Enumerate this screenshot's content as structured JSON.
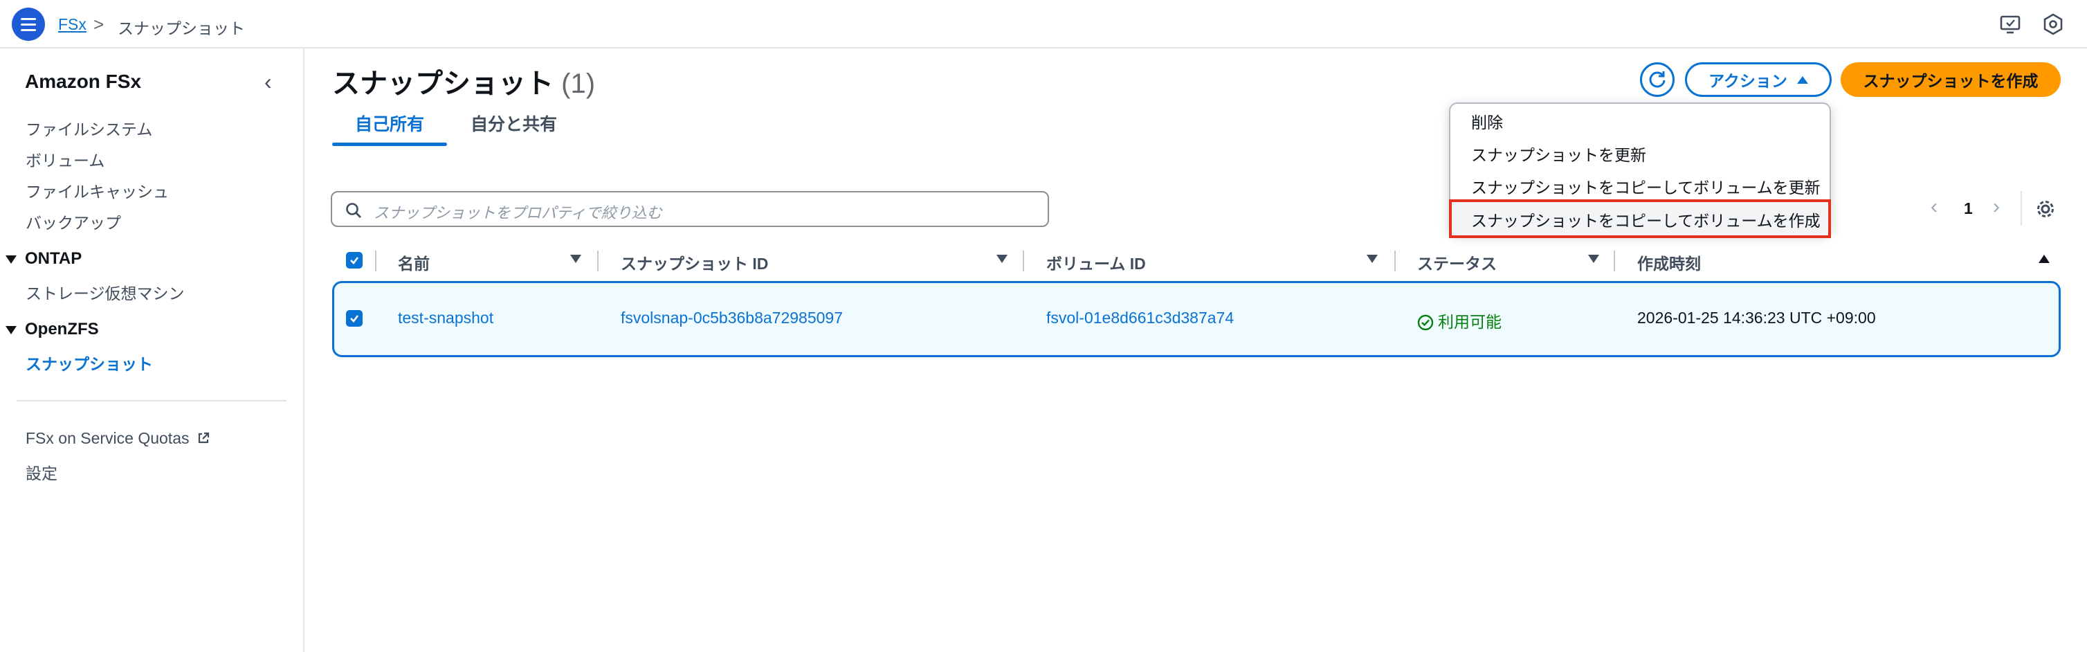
{
  "topbar": {
    "breadcrumb_service": "FSx",
    "breadcrumb_separator": ">",
    "breadcrumb_current": "スナップショット"
  },
  "sidebar": {
    "title": "Amazon FSx",
    "items": [
      "ファイルシステム",
      "ボリューム",
      "ファイルキャッシュ",
      "バックアップ"
    ],
    "ontap_section": "ONTAP",
    "ontap_items": [
      "ストレージ仮想マシン"
    ],
    "openzfs_section": "OpenZFS",
    "openzfs_items": [
      "スナップショット"
    ],
    "footer_items": [
      "FSx on Service Quotas",
      "設定"
    ]
  },
  "main": {
    "title": "スナップショット",
    "count": "(1)",
    "actions_label": "アクション",
    "create_label": "スナップショットを作成",
    "tabs": [
      "自己所有",
      "自分と共有"
    ],
    "search_placeholder": "スナップショットをプロパティで絞り込む",
    "page": "1",
    "columns": [
      "名前",
      "スナップショット ID",
      "ボリューム ID",
      "ステータス",
      "作成時刻"
    ],
    "rows": [
      {
        "name": "test-snapshot",
        "snapshot_id": "fsvolsnap-0c5b36b8a72985097",
        "volume_id": "fsvol-01e8d661c3d387a74",
        "status": "利用可能",
        "created": "2026-01-25 14:36:23 UTC +09:00"
      }
    ]
  },
  "dropdown": {
    "items": [
      "削除",
      "スナップショットを更新",
      "スナップショットをコピーしてボリュームを更新",
      "スナップショットをコピーしてボリュームを作成"
    ]
  },
  "colors": {
    "primary": "#0972d3",
    "accent": "#ff9900",
    "success": "#037f0c",
    "highlight_border": "#e0321f"
  }
}
